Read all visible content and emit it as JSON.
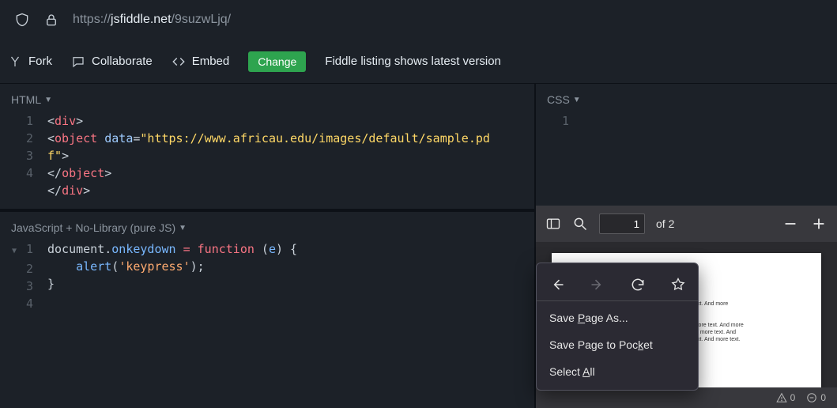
{
  "address": {
    "scheme": "https://",
    "host": "jsfiddle.net",
    "path": "/9suzwLjq/"
  },
  "toolbar": {
    "fork": "Fork",
    "collaborate": "Collaborate",
    "embed": "Embed",
    "change": "Change",
    "notice": "Fiddle listing shows latest version"
  },
  "panes": {
    "html_label": "HTML",
    "css_label": "CSS",
    "js_label": "JavaScript + No-Library (pure JS)"
  },
  "html_code": {
    "l1": {
      "open": "<",
      "tag": "div",
      "close": ">"
    },
    "l2": {
      "open": "<",
      "tag": "object",
      "sp": " ",
      "attr": "data",
      "eq": "=",
      "val": "\"https://www.africau.edu/images/default/sample.pd",
      "wrap": "f\"",
      "close": ">"
    },
    "l3": {
      "open": "</",
      "tag": "object",
      "close": ">"
    },
    "l4": {
      "open": "</",
      "tag": "div",
      "close": ">"
    },
    "line_nums": [
      "1",
      "2",
      "3",
      "4"
    ],
    "line_num_blank": " "
  },
  "css_code": {
    "line_nums": [
      "1"
    ]
  },
  "js_code": {
    "line_nums": [
      "1",
      "2",
      "3",
      "4"
    ],
    "l1": {
      "a": "document",
      "b": ".",
      "c": "onkeydown",
      "d": " ",
      "e": "=",
      "f": " ",
      "g": "function",
      "h": " (",
      "i": "e",
      "j": ") {"
    },
    "l2": {
      "indent": "    ",
      "fn": "alert",
      "open": "(",
      "str": "'keypress'",
      "close": ");"
    },
    "l3": {
      "brace": "}"
    }
  },
  "pdf": {
    "page_num": "1",
    "page_of": "of 2",
    "doc_text": "re text. And more\nd.\n\nnd more text. And more\n. And more text. And\nre text. And more text.",
    "errors": "0",
    "warnings": "0"
  },
  "ctx": {
    "save_as": "Save Page As...",
    "save_pocket_pre": "Save Page to Poc",
    "save_pocket_u": "k",
    "save_pocket_post": "et",
    "select_pre": "Select ",
    "select_u": "A",
    "select_post": "ll",
    "save_as_u": "P"
  }
}
